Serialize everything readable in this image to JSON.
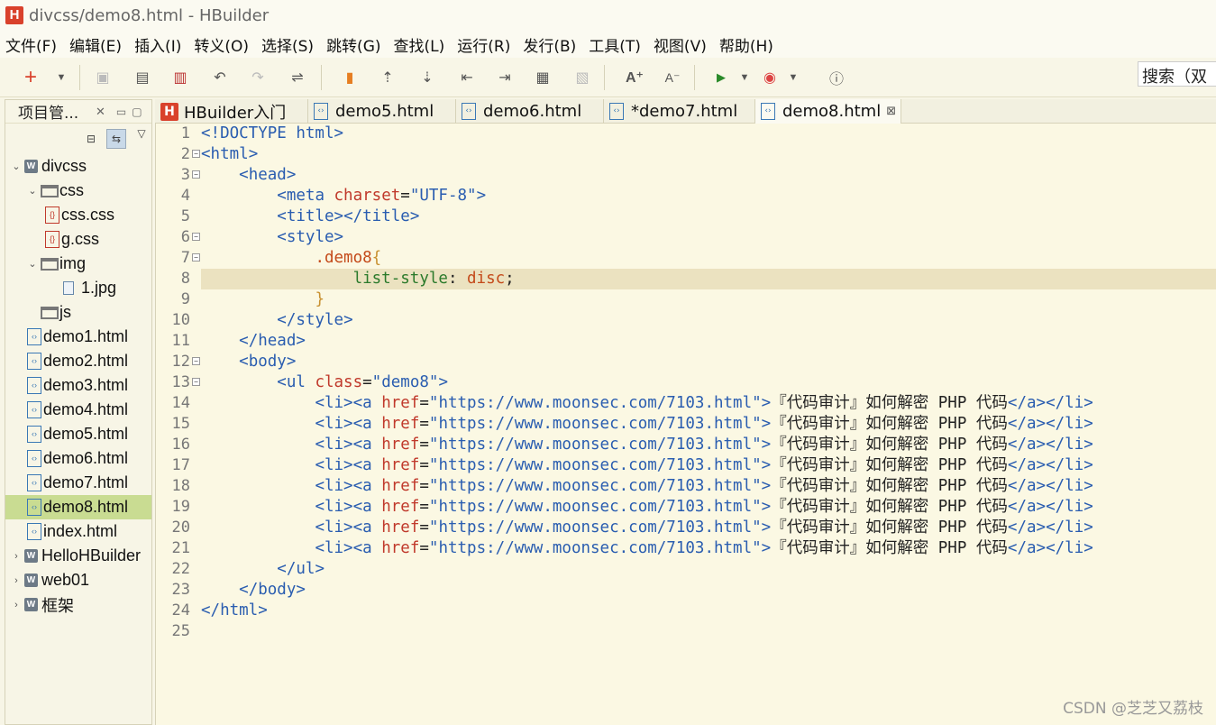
{
  "window": {
    "title": "divcss/demo8.html  -  HBuilder",
    "logo": "H"
  },
  "menu": [
    "文件(F)",
    "编辑(E)",
    "插入(I)",
    "转义(O)",
    "选择(S)",
    "跳转(G)",
    "查找(L)",
    "运行(R)",
    "发行(B)",
    "工具(T)",
    "视图(V)",
    "帮助(H)"
  ],
  "search": {
    "value": "搜索（双"
  },
  "project_panel": {
    "title": "项目管...",
    "tree": [
      {
        "label": "divcss",
        "kind": "project",
        "expanded": true,
        "depth": 0
      },
      {
        "label": "css",
        "kind": "folder",
        "expanded": true,
        "depth": 1
      },
      {
        "label": "css.css",
        "kind": "css",
        "depth": 2
      },
      {
        "label": "g.css",
        "kind": "css",
        "depth": 2
      },
      {
        "label": "img",
        "kind": "folder",
        "expanded": true,
        "depth": 1
      },
      {
        "label": "1.jpg",
        "kind": "image",
        "depth": 2
      },
      {
        "label": "js",
        "kind": "folder",
        "depth": 1
      },
      {
        "label": "demo1.html",
        "kind": "html",
        "depth": 1
      },
      {
        "label": "demo2.html",
        "kind": "html",
        "depth": 1
      },
      {
        "label": "demo3.html",
        "kind": "html",
        "depth": 1
      },
      {
        "label": "demo4.html",
        "kind": "html",
        "depth": 1
      },
      {
        "label": "demo5.html",
        "kind": "html",
        "depth": 1
      },
      {
        "label": "demo6.html",
        "kind": "html",
        "depth": 1
      },
      {
        "label": "demo7.html",
        "kind": "html",
        "depth": 1
      },
      {
        "label": "demo8.html",
        "kind": "html",
        "depth": 1,
        "selected": true
      },
      {
        "label": "index.html",
        "kind": "html",
        "depth": 1
      },
      {
        "label": "HelloHBuilder",
        "kind": "project",
        "expanded": false,
        "depth": 0
      },
      {
        "label": "web01",
        "kind": "project",
        "expanded": false,
        "depth": 0
      },
      {
        "label": "框架",
        "kind": "project",
        "expanded": false,
        "depth": 0
      }
    ]
  },
  "editor_tabs": [
    {
      "label": "HBuilder入门",
      "icon": "hbuilder-icon"
    },
    {
      "label": "demo5.html",
      "icon": "html-file-icon"
    },
    {
      "label": "demo6.html",
      "icon": "html-file-icon"
    },
    {
      "label": "*demo7.html",
      "icon": "html-file-icon"
    },
    {
      "label": "demo8.html",
      "icon": "html-file-icon",
      "active": true,
      "closable": true
    }
  ],
  "editor": {
    "current_line": 8,
    "lines": [
      "<!DOCTYPE html>",
      "<html>",
      "    <head>",
      "        <meta charset=\"UTF-8\">",
      "        <title></title>",
      "        <style>",
      "            .demo8{",
      "                list-style: disc;",
      "            }",
      "        </style>",
      "    </head>",
      "    <body>",
      "        <ul class=\"demo8\">",
      "            <li><a href=\"https://www.moonsec.com/7103.html\">『代码审计』如何解密 PHP 代码</a></li>",
      "            <li><a href=\"https://www.moonsec.com/7103.html\">『代码审计』如何解密 PHP 代码</a></li>",
      "            <li><a href=\"https://www.moonsec.com/7103.html\">『代码审计』如何解密 PHP 代码</a></li>",
      "            <li><a href=\"https://www.moonsec.com/7103.html\">『代码审计』如何解密 PHP 代码</a></li>",
      "            <li><a href=\"https://www.moonsec.com/7103.html\">『代码审计』如何解密 PHP 代码</a></li>",
      "            <li><a href=\"https://www.moonsec.com/7103.html\">『代码审计』如何解密 PHP 代码</a></li>",
      "            <li><a href=\"https://www.moonsec.com/7103.html\">『代码审计』如何解密 PHP 代码</a></li>",
      "            <li><a href=\"https://www.moonsec.com/7103.html\">『代码审计』如何解密 PHP 代码</a></li>",
      "        </ul>",
      "    </body>",
      "</html>",
      ""
    ],
    "foldable_lines": [
      2,
      3,
      6,
      7,
      12,
      13
    ]
  },
  "watermark": "CSDN @芝芝又荔枝",
  "colors": {
    "background": "#fbf8e3",
    "current_line": "#ebe2c0",
    "selection": "#c9dc92",
    "tag": "#2a5db0",
    "attribute": "#c0392b"
  }
}
